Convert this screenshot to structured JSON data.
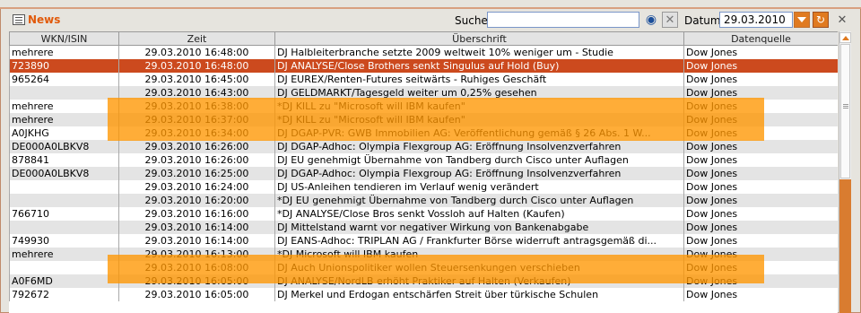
{
  "panel": {
    "title": "News"
  },
  "search": {
    "label": "Suche",
    "value": ""
  },
  "date": {
    "label": "Datum",
    "value": "29.03.2010"
  },
  "colors": {
    "accent": "#e07a20",
    "selected_row": "#cc4a1e",
    "highlight": "#ff9600"
  },
  "table": {
    "columns": [
      "WKN/ISIN",
      "Zeit",
      "Überschrift",
      "Datenquelle"
    ],
    "rows": [
      {
        "wkn": "mehrere",
        "time": "29.03.2010 16:48:00",
        "headline": "DJ Halbleiterbranche setzte 2009 weltweit 10% weniger um - Studie",
        "source": "Dow Jones"
      },
      {
        "wkn": "723890",
        "time": "29.03.2010 16:48:00",
        "headline": "DJ ANALYSE/Close Brothers senkt Singulus auf Hold (Buy)",
        "source": "Dow Jones"
      },
      {
        "wkn": "965264",
        "time": "29.03.2010 16:45:00",
        "headline": "DJ EUREX/Renten-Futures seitwärts - Ruhiges Geschäft",
        "source": "Dow Jones"
      },
      {
        "wkn": "",
        "time": "29.03.2010 16:43:00",
        "headline": "DJ GELDMARKT/Tagesgeld weiter um 0,25% gesehen",
        "source": "Dow Jones"
      },
      {
        "wkn": "mehrere",
        "time": "29.03.2010 16:38:00",
        "headline": "*DJ KILL zu \"Microsoft will IBM kaufen\"",
        "source": "Dow Jones"
      },
      {
        "wkn": "mehrere",
        "time": "29.03.2010 16:37:00",
        "headline": "*DJ KILL zu \"Microsoft will IBM kaufen\"",
        "source": "Dow Jones"
      },
      {
        "wkn": "A0JKHG",
        "time": "29.03.2010 16:34:00",
        "headline": "DJ DGAP-PVR: GWB Immobilien AG: Veröffentlichung gemäß § 26 Abs. 1 W...",
        "source": "Dow Jones"
      },
      {
        "wkn": "DE000A0LBKV8",
        "time": "29.03.2010 16:26:00",
        "headline": "DJ DGAP-Adhoc: Olympia Flexgroup AG: Eröffnung Insolvenzverfahren",
        "source": "Dow Jones"
      },
      {
        "wkn": "878841",
        "time": "29.03.2010 16:26:00",
        "headline": "DJ EU genehmigt Übernahme von Tandberg durch Cisco unter Auflagen",
        "source": "Dow Jones"
      },
      {
        "wkn": "DE000A0LBKV8",
        "time": "29.03.2010 16:25:00",
        "headline": "DJ DGAP-Adhoc: Olympia Flexgroup AG: Eröffnung Insolvenzverfahren",
        "source": "Dow Jones"
      },
      {
        "wkn": "",
        "time": "29.03.2010 16:24:00",
        "headline": "DJ US-Anleihen tendieren im Verlauf wenig verändert",
        "source": "Dow Jones"
      },
      {
        "wkn": "",
        "time": "29.03.2010 16:20:00",
        "headline": "*DJ EU genehmigt Übernahme von Tandberg durch Cisco unter Auflagen",
        "source": "Dow Jones"
      },
      {
        "wkn": "766710",
        "time": "29.03.2010 16:16:00",
        "headline": "*DJ ANALYSE/Close Bros senkt Vossloh auf Halten (Kaufen)",
        "source": "Dow Jones"
      },
      {
        "wkn": "",
        "time": "29.03.2010 16:14:00",
        "headline": "DJ Mittelstand warnt vor negativer Wirkung von Bankenabgabe",
        "source": "Dow Jones"
      },
      {
        "wkn": "749930",
        "time": "29.03.2010 16:14:00",
        "headline": "DJ EANS-Adhoc: TRIPLAN AG / Frankfurter Börse widerruft antragsgemäß di...",
        "source": "Dow Jones"
      },
      {
        "wkn": "mehrere",
        "time": "29.03.2010 16:13:00",
        "headline": "*DJ Microsoft will IBM kaufen",
        "source": "Dow Jones"
      },
      {
        "wkn": "",
        "time": "29.03.2010 16:08:00",
        "headline": "DJ Auch Unionspolitiker wollen Steuersenkungen verschieben",
        "source": "Dow Jones"
      },
      {
        "wkn": "A0F6MD",
        "time": "29.03.2010 16:05:00",
        "headline": "DJ ANALYSE/NordLB erhöht Praktiker auf Halten (Verkaufen)",
        "source": "Dow Jones"
      },
      {
        "wkn": "792672",
        "time": "29.03.2010 16:05:00",
        "headline": "DJ Merkel und Erdogan entschärfen Streit über türkische Schulen",
        "source": "Dow Jones"
      }
    ]
  }
}
